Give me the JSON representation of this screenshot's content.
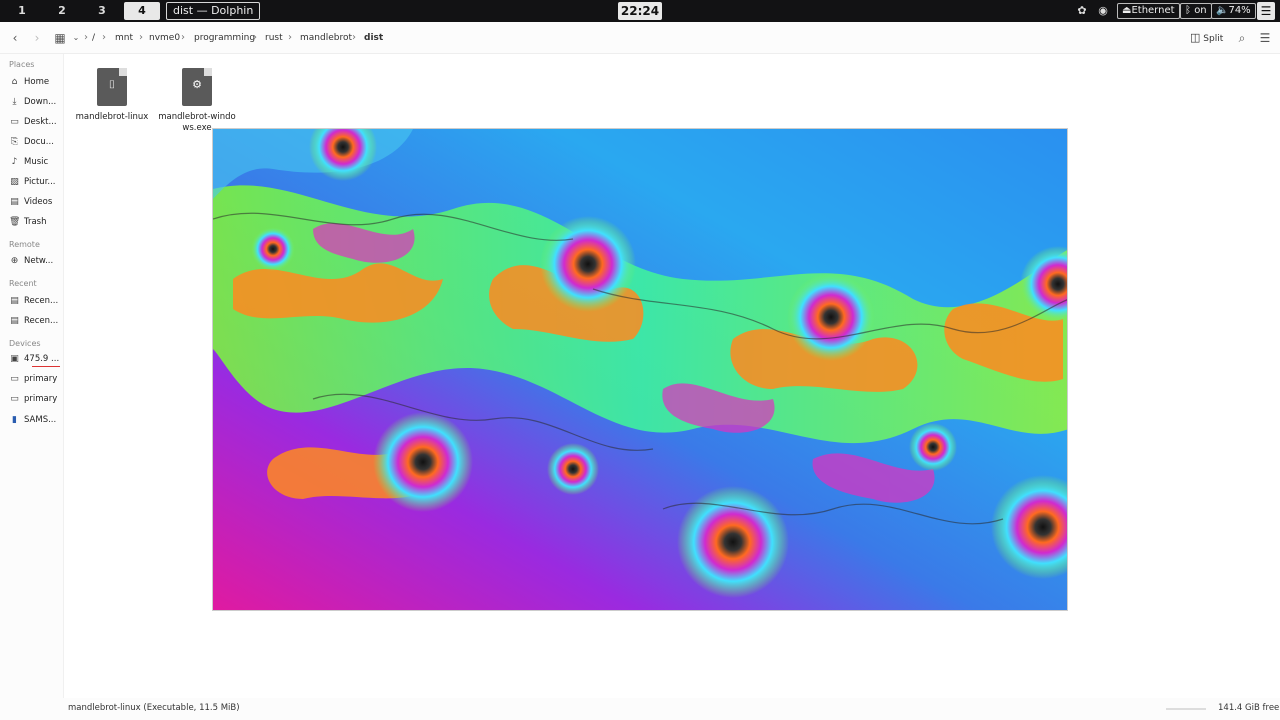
{
  "topbar": {
    "workspaces": [
      "1",
      "2",
      "3",
      "4"
    ],
    "active_workspace": "4",
    "window_title": "dist — Dolphin",
    "clock": "22:24",
    "ethernet": "Ethernet",
    "bluetooth": "on",
    "volume": "74%"
  },
  "toolbar": {
    "breadcrumb": [
      "/",
      "mnt",
      "nvme0",
      "programming",
      "rust",
      "mandlebrot",
      "dist"
    ],
    "split_label": "Split"
  },
  "sidebar": {
    "places_title": "Places",
    "places": [
      {
        "label": "Home",
        "icon": "home-icon"
      },
      {
        "label": "Down...",
        "icon": "download-icon"
      },
      {
        "label": "Deskt...",
        "icon": "desktop-icon"
      },
      {
        "label": "Docu...",
        "icon": "document-icon"
      },
      {
        "label": "Music",
        "icon": "music-icon"
      },
      {
        "label": "Pictur...",
        "icon": "picture-icon"
      },
      {
        "label": "Videos",
        "icon": "video-icon"
      },
      {
        "label": "Trash",
        "icon": "trash-icon"
      }
    ],
    "remote_title": "Remote",
    "remote": [
      {
        "label": "Netw...",
        "icon": "network-icon"
      }
    ],
    "recent_title": "Recent",
    "recent": [
      {
        "label": "Recen...",
        "icon": "recent-files-icon"
      },
      {
        "label": "Recen...",
        "icon": "recent-locations-icon"
      }
    ],
    "devices_title": "Devices",
    "devices": [
      {
        "label": "475.9 ...",
        "icon": "drive-icon"
      },
      {
        "label": "primary",
        "icon": "drive-icon"
      },
      {
        "label": "primary",
        "icon": "drive-icon"
      },
      {
        "label": "SAMS...",
        "icon": "usb-drive-icon"
      }
    ]
  },
  "files": [
    {
      "name": "mandlebrot-linux",
      "icon": "executable-icon"
    },
    {
      "name": "mandlebrot-windows.exe",
      "icon": "windows-exe-icon"
    }
  ],
  "status": {
    "text": "mandlebrot-linux (Executable, 11.5 MiB)",
    "free": "141.4 GiB free"
  }
}
